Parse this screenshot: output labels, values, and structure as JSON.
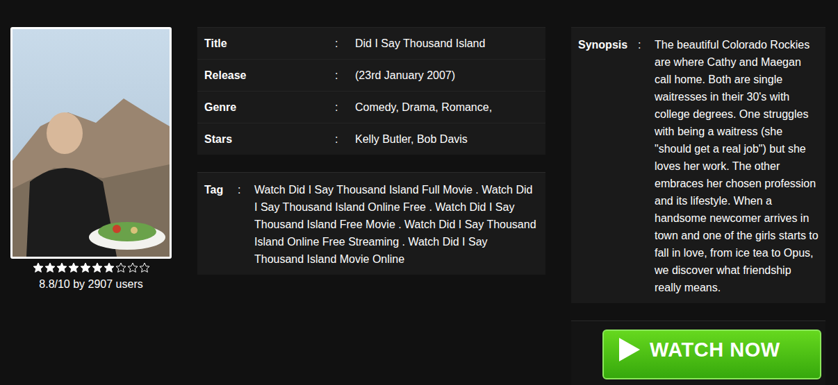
{
  "rating": {
    "stars": 7,
    "max": 10,
    "text": "8.8/10 by 2907 users"
  },
  "separator": ":",
  "details": [
    {
      "label": "Title",
      "value": "Did I Say Thousand Island"
    },
    {
      "label": "Release",
      "value": "(23rd January 2007)"
    },
    {
      "label": "Genre",
      "value": "Comedy, Drama, Romance,"
    },
    {
      "label": "Stars",
      "value": "Kelly Butler, Bob Davis"
    }
  ],
  "tag": {
    "label": "Tag",
    "text": "Watch Did I Say Thousand Island Full Movie . Watch Did I Say Thousand Island Online Free . Watch Did I Say Thousand Island Free Movie . Watch Did I Say Thousand Island Online Free Streaming . Watch Did I Say Thousand Island Movie Online"
  },
  "synopsis": {
    "label": "Synopsis",
    "text": "The beautiful Colorado Rockies are where Cathy and Maegan call home. Both are single waitresses in their 30's with college degrees. One struggles with being a waitress (she \"should get a real job\") but she loves her work. The other embraces her chosen profession and its lifestyle. When a handsome newcomer arrives in town and one of the girls starts to fall in love, from ice tea to Opus, we discover what friendship really means."
  },
  "watch_button": {
    "label": "WATCH NOW"
  }
}
